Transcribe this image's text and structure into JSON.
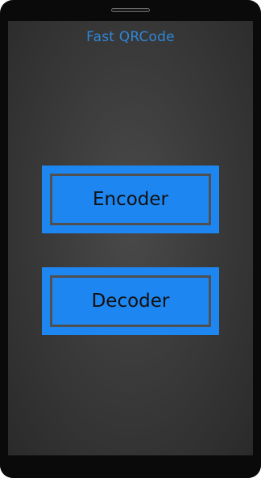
{
  "app": {
    "title": "Fast QRCode"
  },
  "buttons": {
    "encoder_label": "Encoder",
    "decoder_label": "Decoder"
  },
  "colors": {
    "accent": "#1e86f0",
    "title": "#2f86d8",
    "button_border": "#505050",
    "background": "#3b3b3b"
  }
}
